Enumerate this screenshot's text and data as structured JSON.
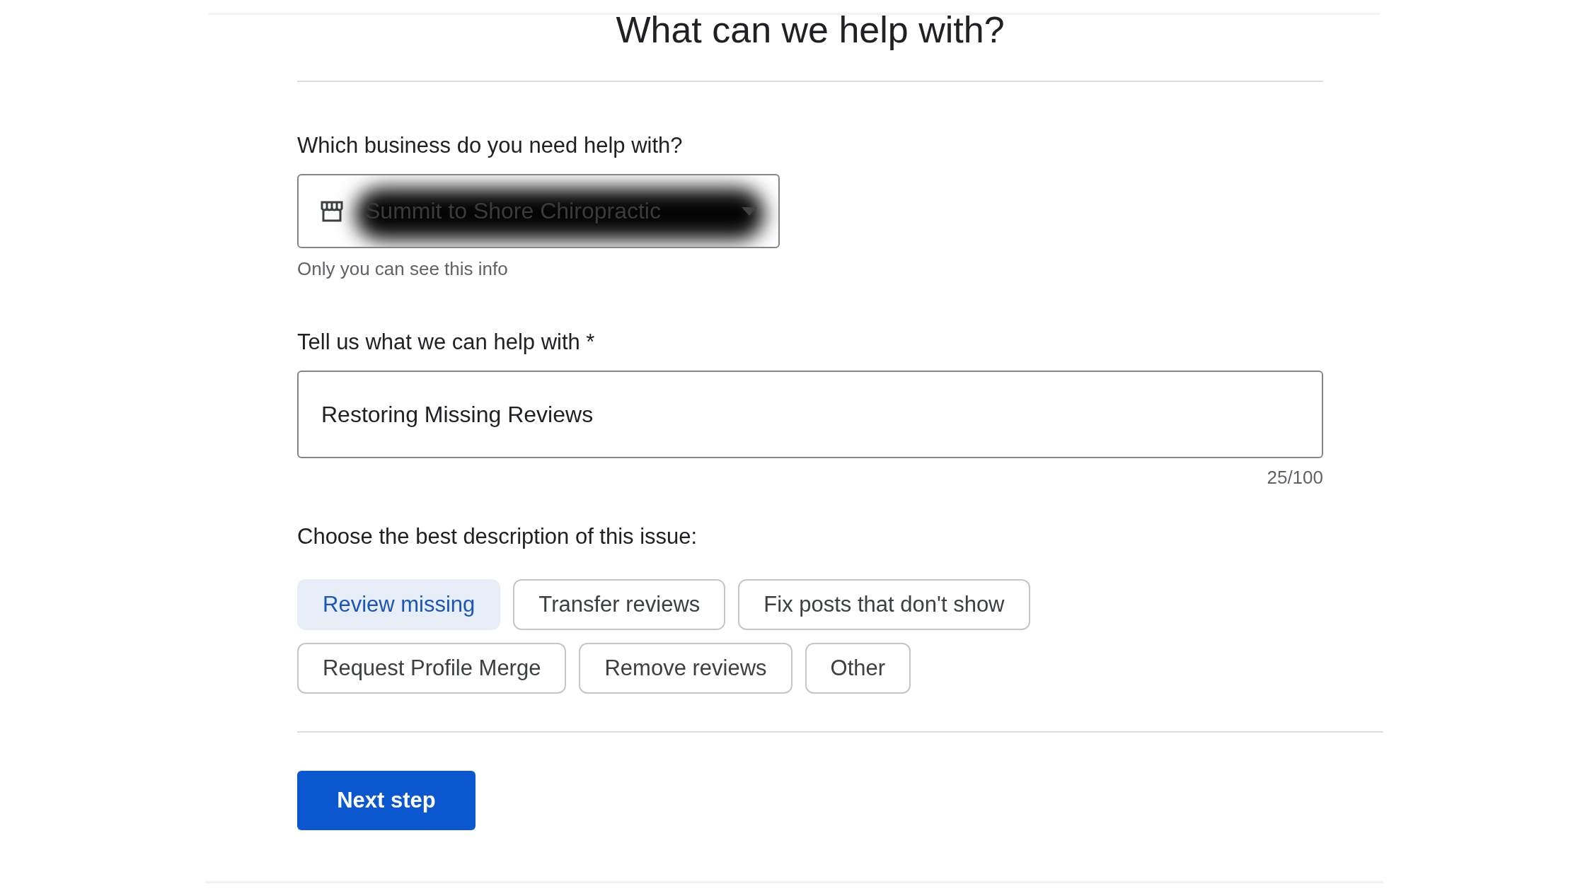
{
  "title": "What can we help with?",
  "business": {
    "label": "Which business do you need help with?",
    "value": "Summit to Shore Chiropractic",
    "helper": "Only you can see this info"
  },
  "issue": {
    "label": "Tell us what we can help with *",
    "value": "Restoring Missing Reviews",
    "counter": "25/100"
  },
  "description": {
    "label": "Choose the best description of this issue:",
    "options": [
      {
        "label": "Review missing",
        "selected": true
      },
      {
        "label": "Transfer reviews",
        "selected": false
      },
      {
        "label": "Fix posts that don't show",
        "selected": false
      },
      {
        "label": "Request Profile Merge",
        "selected": false
      },
      {
        "label": "Remove reviews",
        "selected": false
      },
      {
        "label": "Other",
        "selected": false
      }
    ]
  },
  "next_button": "Next step"
}
